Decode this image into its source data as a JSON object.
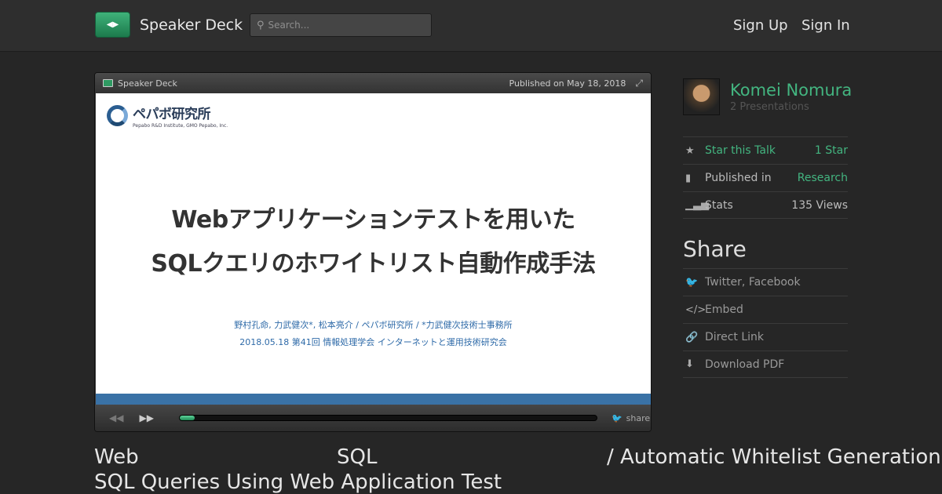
{
  "header": {
    "brand": "Speaker Deck",
    "search_placeholder": "Search...",
    "sign_up": "Sign Up",
    "sign_in": "Sign In"
  },
  "player": {
    "brand": "Speaker Deck",
    "published": "Published on May 18, 2018",
    "share": "share",
    "progress_fraction": 0.035
  },
  "slide": {
    "logo_text": "ペパボ研究所",
    "logo_sub": "Pepabo R&D Institute, GMO Pepabo, Inc.",
    "title_line1": "Webアプリケーションテストを用いた",
    "title_line2": "SQLクエリのホワイトリスト自動作成手法",
    "authors": "野村孔命, 力武健次*, 松本亮介 / ペパボ研究所 / *力武健次技術士事務所",
    "event": "2018.05.18 第41回 情報処理学会 インターネットと運用技術研究会"
  },
  "author": {
    "name": "Komei Nomura",
    "presentations": "2 Presentations"
  },
  "stats": {
    "star_label": "Star this Talk",
    "star_value": "1 Star",
    "published_label": "Published in",
    "published_value": "Research",
    "stats_label": "Stats",
    "stats_value": "135 Views"
  },
  "share": {
    "title": "Share",
    "twitter": "Twitter, Facebook",
    "embed": "Embed",
    "direct": "Direct Link",
    "pdf": "Download PDF"
  },
  "description": {
    "part1": "Web",
    "part2": "SQL",
    "part3": "/ Automatic Whitelist Generation for",
    "line2": "SQL Queries Using Web Application Test"
  },
  "colors": {
    "accent": "#43b580",
    "background": "#262626"
  }
}
